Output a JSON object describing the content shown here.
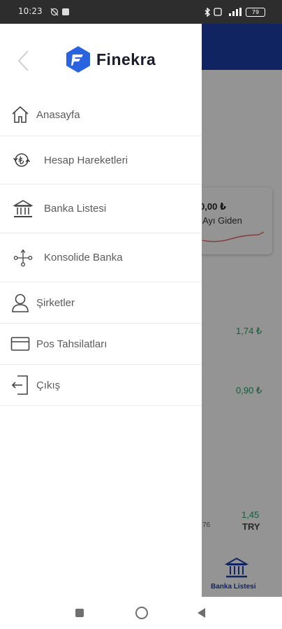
{
  "status_bar": {
    "time": "10:23",
    "battery": "79"
  },
  "background": {
    "card_value": "0,00 ₺",
    "card_label": "Ayı Giden",
    "values": [
      "1,74 ₺",
      "0,90 ₺",
      "1,45"
    ],
    "currency": "TRY",
    "small_text": "76",
    "nav_label": "Banka Listesi"
  },
  "drawer": {
    "logo_text": "Finekra",
    "menu": [
      {
        "label": "Anasayfa",
        "icon": "home-icon"
      },
      {
        "label": "Hesap Hareketleri",
        "icon": "lira-cycle-icon"
      },
      {
        "label": "Banka Listesi",
        "icon": "bank-icon"
      },
      {
        "label": "Konsolide Banka",
        "icon": "consolidate-icon"
      },
      {
        "label": "Şirketler",
        "icon": "person-icon"
      },
      {
        "label": "Pos Tahsilatları",
        "icon": "credit-card-icon"
      },
      {
        "label": "Çıkış",
        "icon": "logout-icon"
      }
    ]
  },
  "colors": {
    "brand": "#1b3fa6",
    "logo": "#2a63e0",
    "positive": "#1aa85e"
  }
}
